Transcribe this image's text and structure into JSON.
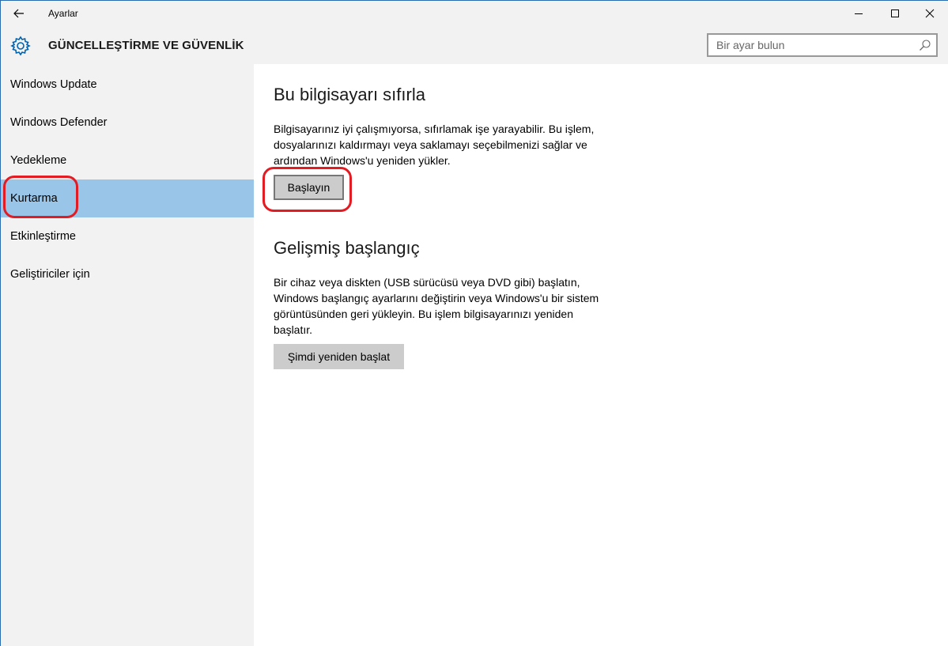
{
  "window": {
    "title": "Ayarlar"
  },
  "header": {
    "section_title": "GÜNCELLEŞTİRME VE GÜVENLİK",
    "search_placeholder": "Bir ayar bulun"
  },
  "sidebar": {
    "items": [
      {
        "label": "Windows Update"
      },
      {
        "label": "Windows Defender"
      },
      {
        "label": "Yedekleme"
      },
      {
        "label": "Kurtarma",
        "selected": true
      },
      {
        "label": "Etkinleştirme"
      },
      {
        "label": "Geliştiriciler için"
      }
    ]
  },
  "main": {
    "reset": {
      "heading": "Bu bilgisayarı sıfırla",
      "line1": "Bilgisayarınız iyi çalışmıyorsa, sıfırlamak işe yarayabilir. Bu işlem,",
      "line2": "dosyalarınızı kaldırmayı veya saklamayı seçebilmenizi sağlar ve",
      "line3": "ardından Windows'u yeniden yükler.",
      "button": "Başlayın"
    },
    "advanced": {
      "heading": "Gelişmiş başlangıç",
      "line1": "Bir cihaz veya diskten (USB sürücüsü veya DVD gibi) başlatın,",
      "line2": "Windows başlangıç ayarlarını değiştirin veya Windows'u bir sistem",
      "line3": "görüntüsünden geri yükleyin. Bu işlem bilgisayarınızı yeniden",
      "line4": "başlatır.",
      "button": "Şimdi yeniden başlat"
    }
  },
  "colors": {
    "chrome_bg": "#f2f2f2",
    "selected_bg": "#99c5e8",
    "accent": "#0063b1",
    "annotation": "#e31b23"
  },
  "icons": {
    "back": "arrow-left",
    "gear": "gear",
    "search": "magnifier",
    "minimize": "minus",
    "maximize": "square",
    "close": "x"
  }
}
